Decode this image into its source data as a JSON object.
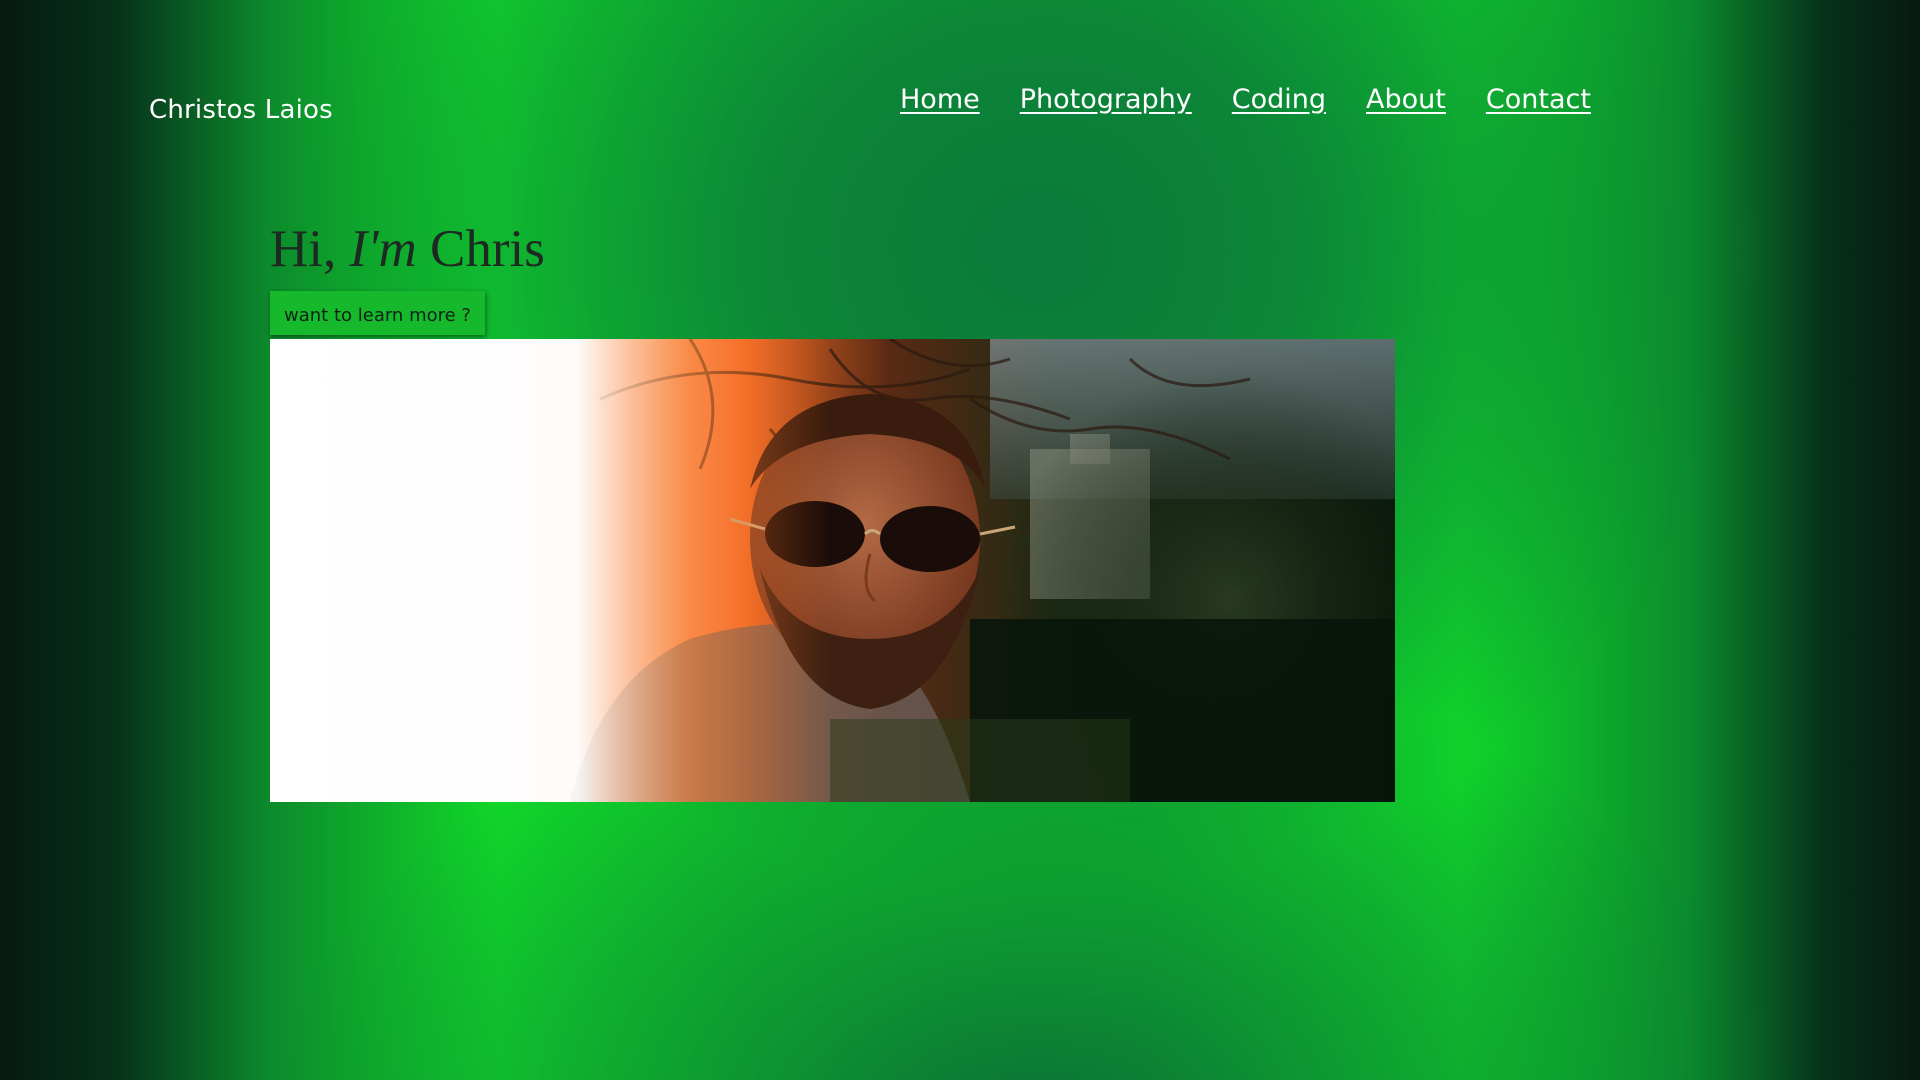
{
  "header": {
    "brand": "Christos Laios",
    "nav": [
      {
        "label": "Home"
      },
      {
        "label": "Photography"
      },
      {
        "label": "Coding"
      },
      {
        "label": "About"
      },
      {
        "label": "Contact"
      }
    ]
  },
  "hero": {
    "greeting": "Hi,",
    "emphasis": "I'm",
    "name": "Chris",
    "button_label": "want to learn more ?"
  },
  "colors": {
    "accent_green": "#11d82a",
    "dark_green": "#0b7a3a",
    "title_text": "#1c2a22"
  },
  "icons": []
}
